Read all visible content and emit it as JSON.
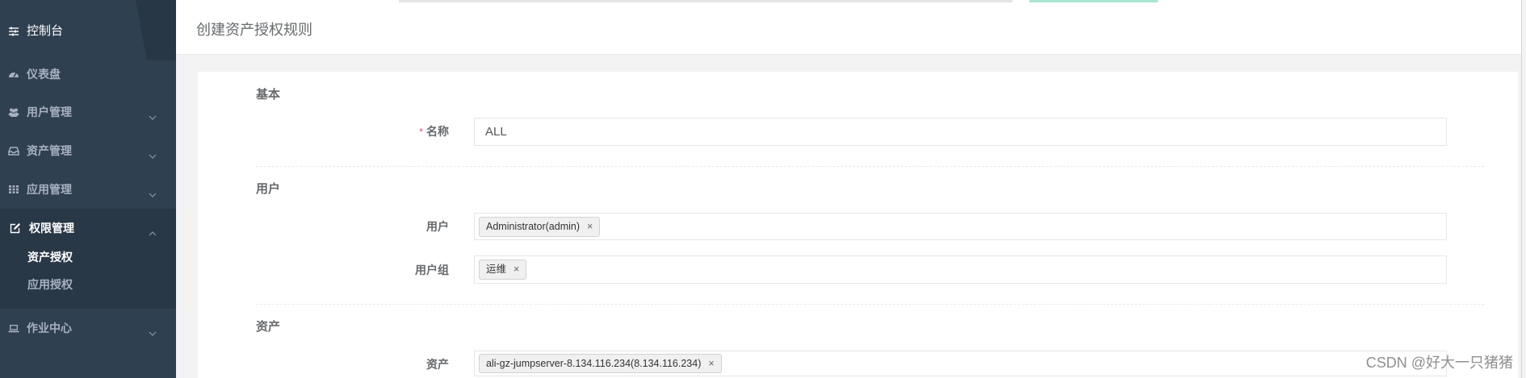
{
  "sidebar": {
    "header": {
      "label": "控制台",
      "icon": "sliders-icon"
    },
    "items": [
      {
        "label": "仪表盘",
        "icon": "dashboard-icon"
      },
      {
        "label": "用户管理",
        "icon": "users-icon",
        "state": "collapsed"
      },
      {
        "label": "资产管理",
        "icon": "inbox-icon",
        "state": "collapsed"
      },
      {
        "label": "应用管理",
        "icon": "grid-icon",
        "state": "collapsed"
      },
      {
        "label": "权限管理",
        "icon": "edit-icon",
        "state": "expanded",
        "active": true,
        "children": [
          {
            "label": "资产授权",
            "active": true
          },
          {
            "label": "应用授权",
            "active": false
          }
        ]
      },
      {
        "label": "作业中心",
        "icon": "laptop-icon",
        "state": "collapsed"
      }
    ]
  },
  "page": {
    "title": "创建资产授权规则"
  },
  "form": {
    "basic": {
      "heading": "基本",
      "name": {
        "required_mark": "*",
        "label": "名称",
        "value": "ALL"
      }
    },
    "user": {
      "heading": "用户",
      "users": {
        "label": "用户",
        "tags": [
          "Administrator(admin)"
        ]
      },
      "user_groups": {
        "label": "用户组",
        "tags": [
          "运维"
        ]
      }
    },
    "asset": {
      "heading": "资产",
      "assets": {
        "label": "资产",
        "tags": [
          "ali-gz-jumpserver-8.134.116.234(8.134.116.234)"
        ]
      }
    }
  },
  "tag_remove_glyph": "×",
  "watermark": "CSDN @好大一只猪猪",
  "colors": {
    "sidebar_bg": "#2f4050",
    "sidebar_active_bg": "#293846",
    "sidebar_text": "#a7b1c2",
    "page_bg": "#f3f3f4",
    "required": "#ed5565"
  }
}
